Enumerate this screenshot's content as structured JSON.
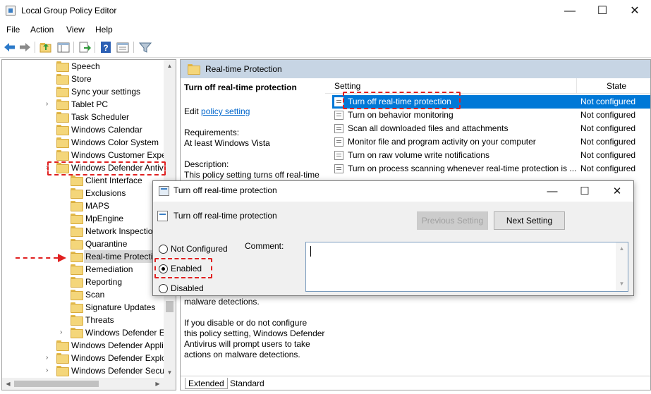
{
  "window": {
    "title": "Local Group Policy Editor",
    "controls": {
      "minimize": "—",
      "maximize": "☐",
      "close": "✕"
    }
  },
  "menu": [
    "File",
    "Action",
    "View",
    "Help"
  ],
  "toolbar": [
    "back-icon",
    "forward-icon",
    "up-folder-icon",
    "show-hide-tree-icon",
    "export-icon",
    "help-icon",
    "properties-icon",
    "filter-icon"
  ],
  "tree": {
    "items": [
      {
        "label": "Speech",
        "expandable": false
      },
      {
        "label": "Store",
        "expandable": false
      },
      {
        "label": "Sync your settings",
        "expandable": false
      },
      {
        "label": "Tablet PC",
        "expandable": true
      },
      {
        "label": "Task Scheduler",
        "expandable": false
      },
      {
        "label": "Windows Calendar",
        "expandable": false
      },
      {
        "label": "Windows Color System",
        "expandable": false
      },
      {
        "label": "Windows Customer Expe",
        "expandable": false
      },
      {
        "label": "Windows Defender Antiv",
        "expandable": true
      },
      {
        "label": "Client Interface",
        "expandable": false
      },
      {
        "label": "Exclusions",
        "expandable": false
      },
      {
        "label": "MAPS",
        "expandable": false
      },
      {
        "label": "MpEngine",
        "expandable": false
      },
      {
        "label": "Network Inspectio",
        "expandable": false
      },
      {
        "label": "Quarantine",
        "expandable": false
      },
      {
        "label": "Real-time Protecti",
        "expandable": false,
        "selected": true
      },
      {
        "label": "Remediation",
        "expandable": false
      },
      {
        "label": "Reporting",
        "expandable": false
      },
      {
        "label": "Scan",
        "expandable": false
      },
      {
        "label": "Signature Updates",
        "expandable": false
      },
      {
        "label": "Threats",
        "expandable": false
      },
      {
        "label": "Windows Defender Ex",
        "expandable": true
      },
      {
        "label": "Windows Defender Appli",
        "expandable": false
      },
      {
        "label": "Windows Defender Explo",
        "expandable": true
      },
      {
        "label": "Windows Defender Secur",
        "expandable": true
      }
    ]
  },
  "right": {
    "header_title": "Real-time Protection",
    "description": {
      "title": "Turn off real-time protection",
      "edit_prefix": "Edit ",
      "edit_link": "policy setting ",
      "requirements_label": "Requirements:",
      "requirements_value": "At least Windows Vista",
      "description_label": "Description:",
      "description_first_line": "This policy setting turns off real-time",
      "tail_lines": [
        "malware detections.",
        "",
        "    If you disable or do not configure",
        "this policy setting, Windows Defender",
        "Antivirus will prompt users to take",
        "actions on malware detections."
      ]
    },
    "columns": {
      "setting": "Setting",
      "state": "State"
    },
    "rows": [
      {
        "setting": "Turn off real-time protection",
        "state": "Not configured",
        "selected": true
      },
      {
        "setting": "Turn on behavior monitoring",
        "state": "Not configured"
      },
      {
        "setting": "Scan all downloaded files and attachments",
        "state": "Not configured"
      },
      {
        "setting": "Monitor file and program activity on your computer",
        "state": "Not configured"
      },
      {
        "setting": "Turn on raw volume write notifications",
        "state": "Not configured"
      },
      {
        "setting": "Turn on process scanning whenever real-time protection is ...",
        "state": "Not configured"
      }
    ],
    "tabs": [
      "Extended",
      "Standard"
    ]
  },
  "dialog": {
    "title": "Turn off real-time protection",
    "setting_title": "Turn off real-time protection",
    "previous_button": "Previous Setting",
    "next_button": "Next Setting",
    "options": [
      {
        "label": "Not Configured",
        "checked": false
      },
      {
        "label": "Enabled",
        "checked": true
      },
      {
        "label": "Disabled",
        "checked": false
      }
    ],
    "comment_label": "Comment:",
    "comment_value": ""
  },
  "annotation_color": "#e02020"
}
